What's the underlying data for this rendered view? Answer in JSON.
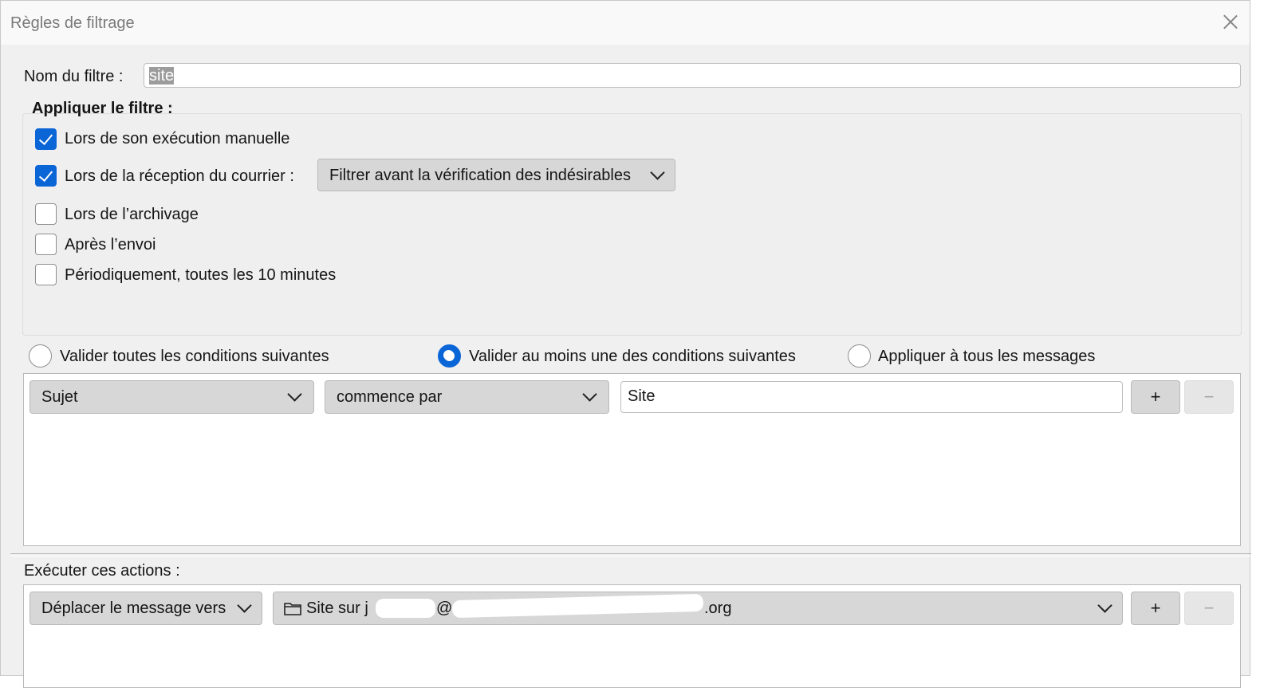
{
  "window": {
    "title": "Règles de filtrage"
  },
  "filter_name": {
    "label": "Nom du filtre :",
    "value": "site"
  },
  "apply": {
    "title": "Appliquer le filtre :",
    "options": [
      {
        "label": "Lors de son exécution manuelle",
        "checked": true
      },
      {
        "label": "Lors de la réception du courrier :",
        "checked": true
      },
      {
        "label": "Lors de l’archivage",
        "checked": false
      },
      {
        "label": "Après l’envoi",
        "checked": false
      },
      {
        "label": "Périodiquement, toutes les 10 minutes",
        "checked": false
      }
    ],
    "reception_mode": "Filtrer avant la vérification des indésirables"
  },
  "match": {
    "options": [
      {
        "label": "Valider toutes les conditions suivantes",
        "selected": false
      },
      {
        "label": "Valider au moins une des conditions suivantes",
        "selected": true
      },
      {
        "label": "Appliquer à tous les messages",
        "selected": false
      }
    ]
  },
  "conditions": [
    {
      "field": "Sujet",
      "operator": "commence par",
      "value": "Site",
      "add": "+",
      "remove": "−"
    }
  ],
  "actions": {
    "label": "Exécuter ces actions :",
    "rows": [
      {
        "action": "Déplacer le message vers",
        "target_start": "Site sur j",
        "target_at": "@",
        "target_end": ".org",
        "add": "+",
        "remove": "−"
      }
    ]
  },
  "colors": {
    "accent": "#0a65d7",
    "button": "#d7d7d7",
    "window_bg": "#f0f0f0"
  }
}
